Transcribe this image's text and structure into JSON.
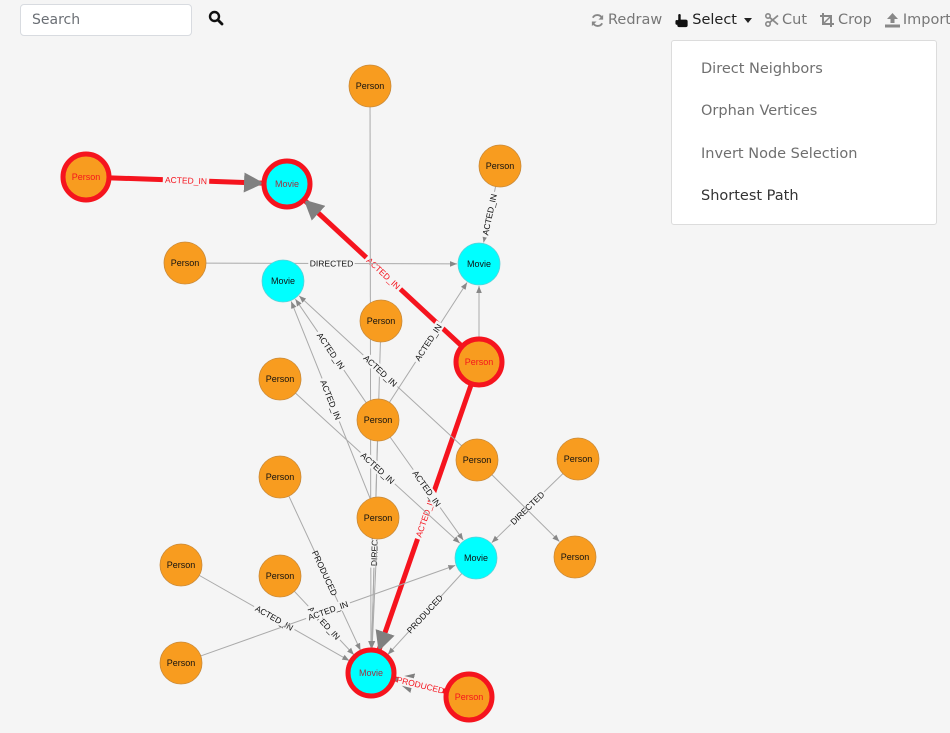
{
  "search": {
    "placeholder": "Search",
    "value": ""
  },
  "icons": {
    "search": "search-icon",
    "redraw": "redraw-icon",
    "select": "hand-pointer-icon",
    "cut": "scissors-icon",
    "crop": "crop-icon",
    "import": "upload-icon"
  },
  "toolbar": {
    "redraw": "Redraw",
    "select": "Select",
    "cut": "Cut",
    "crop": "Crop",
    "import": "Import"
  },
  "select_menu": {
    "items": [
      {
        "label": "Direct Neighbors"
      },
      {
        "label": "Orphan Vertices"
      },
      {
        "label": "Invert Node Selection"
      },
      {
        "label": "Shortest Path"
      }
    ]
  },
  "colors": {
    "person": "#f89c1f",
    "movie": "#00ffff",
    "selected": "#f5141e",
    "edge": "#aaaaaa",
    "arrow": "#888888"
  },
  "graph": {
    "nodes": [
      {
        "id": "p1",
        "label": "Person",
        "type": "person",
        "selected": true
      },
      {
        "id": "m1",
        "label": "Movie",
        "type": "movie",
        "selected": true
      },
      {
        "id": "p2",
        "label": "Person",
        "type": "person",
        "selected": false
      },
      {
        "id": "p3",
        "label": "Person",
        "type": "person",
        "selected": false
      },
      {
        "id": "p4",
        "label": "Person",
        "type": "person",
        "selected": false
      },
      {
        "id": "m2",
        "label": "Movie",
        "type": "movie",
        "selected": false
      },
      {
        "id": "m3",
        "label": "Movie",
        "type": "movie",
        "selected": false
      },
      {
        "id": "p5",
        "label": "Person",
        "type": "person",
        "selected": false
      },
      {
        "id": "p6",
        "label": "Person",
        "type": "person",
        "selected": true
      },
      {
        "id": "p7",
        "label": "Person",
        "type": "person",
        "selected": false
      },
      {
        "id": "p8",
        "label": "Person",
        "type": "person",
        "selected": false
      },
      {
        "id": "p9",
        "label": "Person",
        "type": "person",
        "selected": false
      },
      {
        "id": "p10",
        "label": "Person",
        "type": "person",
        "selected": false
      },
      {
        "id": "p11",
        "label": "Person",
        "type": "person",
        "selected": false
      },
      {
        "id": "p12",
        "label": "Person",
        "type": "person",
        "selected": false
      },
      {
        "id": "m4",
        "label": "Movie",
        "type": "movie",
        "selected": false
      },
      {
        "id": "p13",
        "label": "Person",
        "type": "person",
        "selected": false
      },
      {
        "id": "p14",
        "label": "Person",
        "type": "person",
        "selected": false
      },
      {
        "id": "p15",
        "label": "Person",
        "type": "person",
        "selected": false
      },
      {
        "id": "p16",
        "label": "Person",
        "type": "person",
        "selected": false
      },
      {
        "id": "m5",
        "label": "Movie",
        "type": "movie",
        "selected": true
      },
      {
        "id": "p17",
        "label": "Person",
        "type": "person",
        "selected": true
      }
    ],
    "edges": [
      {
        "from": "p1",
        "to": "m1",
        "label": "ACTED_IN",
        "selected": true
      },
      {
        "from": "p6",
        "to": "m1",
        "label": "ACTED_IN",
        "selected": true
      },
      {
        "from": "p6",
        "to": "m5",
        "label": "ACTED_IN",
        "selected": true
      },
      {
        "from": "p17",
        "to": "m5",
        "label": "PRODUCED",
        "selected": true
      },
      {
        "from": "p2",
        "to": "m5",
        "label": "",
        "selected": false
      },
      {
        "from": "p3",
        "to": "m3",
        "label": "ACTED_IN",
        "selected": false
      },
      {
        "from": "p4",
        "to": "m3",
        "label": "DIRECTED",
        "selected": false
      },
      {
        "from": "p5",
        "to": "m5",
        "label": "",
        "selected": false
      },
      {
        "from": "p6",
        "to": "m3",
        "label": "",
        "selected": false
      },
      {
        "from": "p8",
        "to": "m2",
        "label": "ACTED_IN",
        "selected": false
      },
      {
        "from": "p8",
        "to": "m3",
        "label": "ACTED_IN",
        "selected": false
      },
      {
        "from": "p8",
        "to": "m4",
        "label": "ACTED_IN",
        "selected": false
      },
      {
        "from": "p8",
        "to": "m5",
        "label": "DIRECTED",
        "selected": false
      },
      {
        "from": "p12",
        "to": "m2",
        "label": "ACTED_IN",
        "selected": false
      },
      {
        "from": "p9",
        "to": "m2",
        "label": "ACTED_IN",
        "selected": false
      },
      {
        "from": "p7",
        "to": "m4",
        "label": "ACTED_IN",
        "selected": false
      },
      {
        "from": "p10",
        "to": "m4",
        "label": "DIRECTED",
        "selected": false
      },
      {
        "from": "p9",
        "to": "p13",
        "label": "",
        "selected": false
      },
      {
        "from": "p11",
        "to": "m5",
        "label": "PRODUCED",
        "selected": false
      },
      {
        "from": "p14",
        "to": "m5",
        "label": "ACTED_IN",
        "selected": false
      },
      {
        "from": "p15",
        "to": "m5",
        "label": "ACTED_IN",
        "selected": false
      },
      {
        "from": "p16",
        "to": "m4",
        "label": "ACTED_IN",
        "selected": false
      },
      {
        "from": "m4",
        "to": "m5",
        "label": "PRODUCED",
        "selected": false
      },
      {
        "from": "p12",
        "to": "m5",
        "label": "",
        "selected": false
      }
    ]
  }
}
